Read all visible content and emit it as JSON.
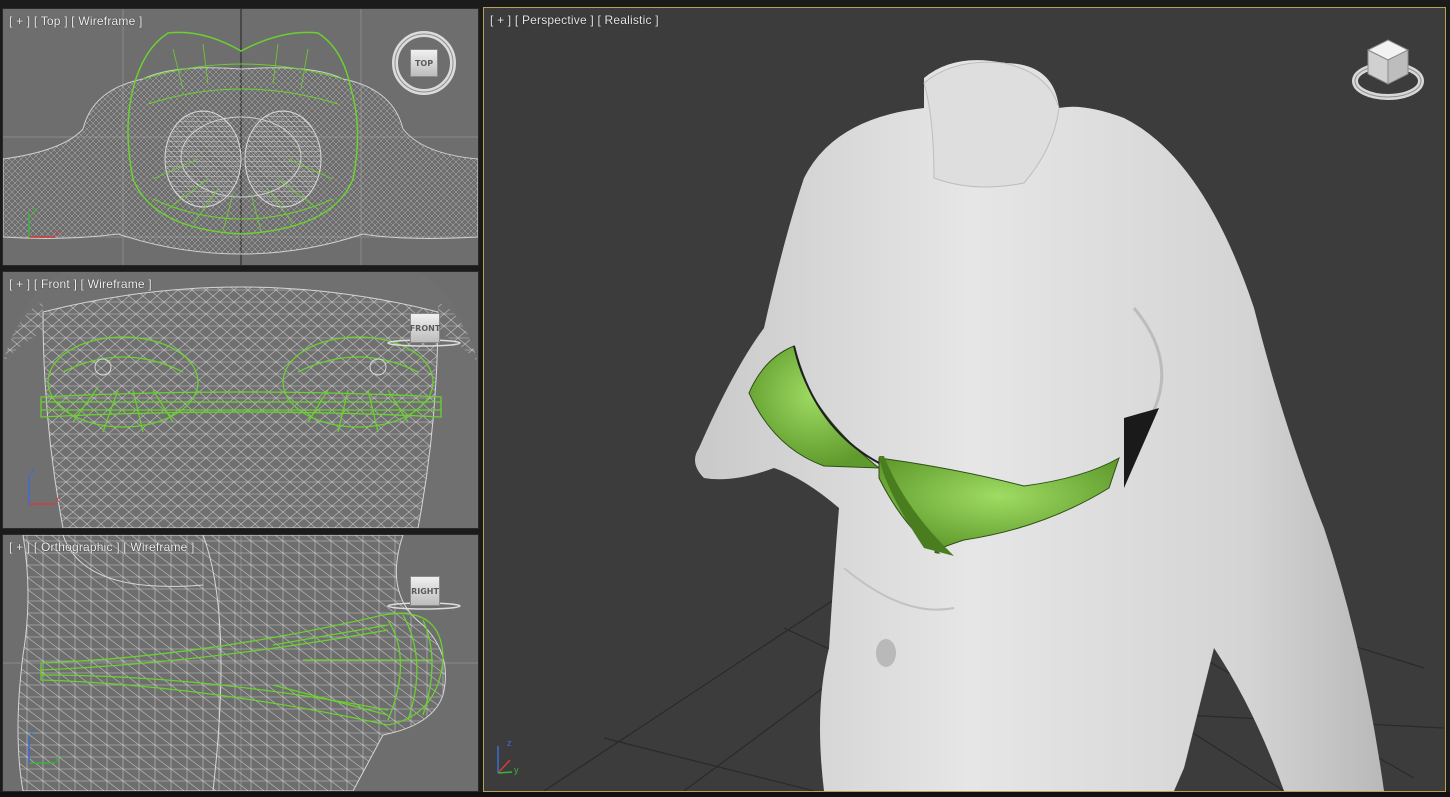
{
  "viewports": {
    "top": {
      "label": "[ + ] [ Top ] [ Wireframe ]",
      "cube_label": "TOP",
      "axis": {
        "x": "x",
        "y": "y"
      }
    },
    "front": {
      "label": "[ + ] [ Front ] [ Wireframe ]",
      "cube_label": "FRONT",
      "axis": {
        "x": "x",
        "z": "z"
      }
    },
    "ortho": {
      "label": "[ + ] [ Orthographic ] [ Wireframe ]",
      "cube_label": "RIGHT",
      "axis": {
        "y": "y",
        "z": "z"
      }
    },
    "perspective": {
      "label": "[ + ] [ Perspective ] [ Realistic ]",
      "cube_labels": [
        "TOP",
        "FRONT",
        "LEFT"
      ],
      "axis": {
        "x": "x",
        "y": "y",
        "z": "z"
      }
    }
  },
  "colors": {
    "wire_grey": "#b4b4b4",
    "wire_green": "#6bd12f",
    "bikini_green": "#8ccf4a",
    "active_border": "#b7a15a",
    "viewport_bg": "#3c3c3c"
  }
}
